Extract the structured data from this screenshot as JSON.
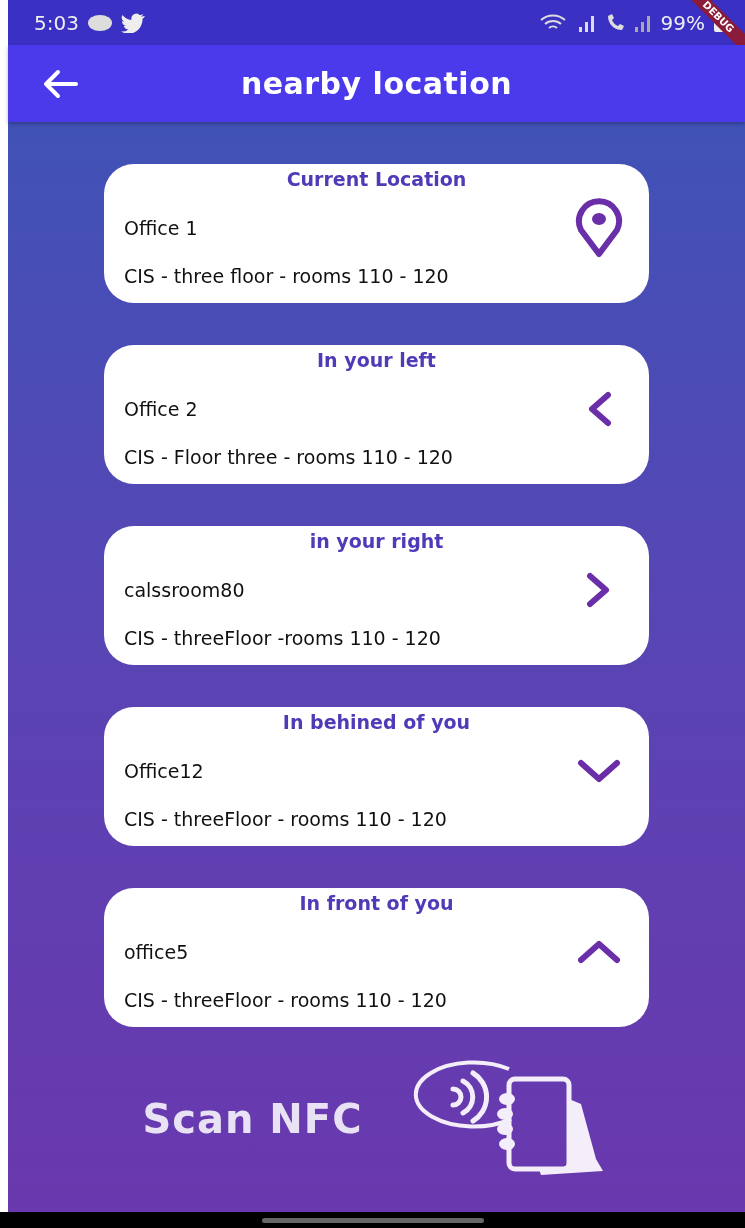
{
  "status_bar": {
    "time": "5:03",
    "battery": "99%",
    "debug_ribbon": "DEBUG"
  },
  "app_bar": {
    "title": "nearby location"
  },
  "locations": [
    {
      "heading": "Current Location",
      "name": "Office 1",
      "detail": "CIS - three floor - rooms 110 - 120",
      "kind": "pin"
    },
    {
      "heading": "In your left",
      "name": "Office 2",
      "detail": "CIS - Floor three - rooms 110 - 120",
      "kind": "left"
    },
    {
      "heading": "in your right",
      "name": "calssroom80",
      "detail": "CIS - threeFloor -rooms 110 - 120",
      "kind": "right"
    },
    {
      "heading": "In behined of you",
      "name": "Office12",
      "detail": "CIS - threeFloor  - rooms 110 - 120",
      "kind": "down"
    },
    {
      "heading": "In front of you",
      "name": "office5",
      "detail": "CIS - threeFloor - rooms 110 - 120",
      "kind": "up"
    }
  ],
  "nfc": {
    "label": "Scan NFC"
  }
}
